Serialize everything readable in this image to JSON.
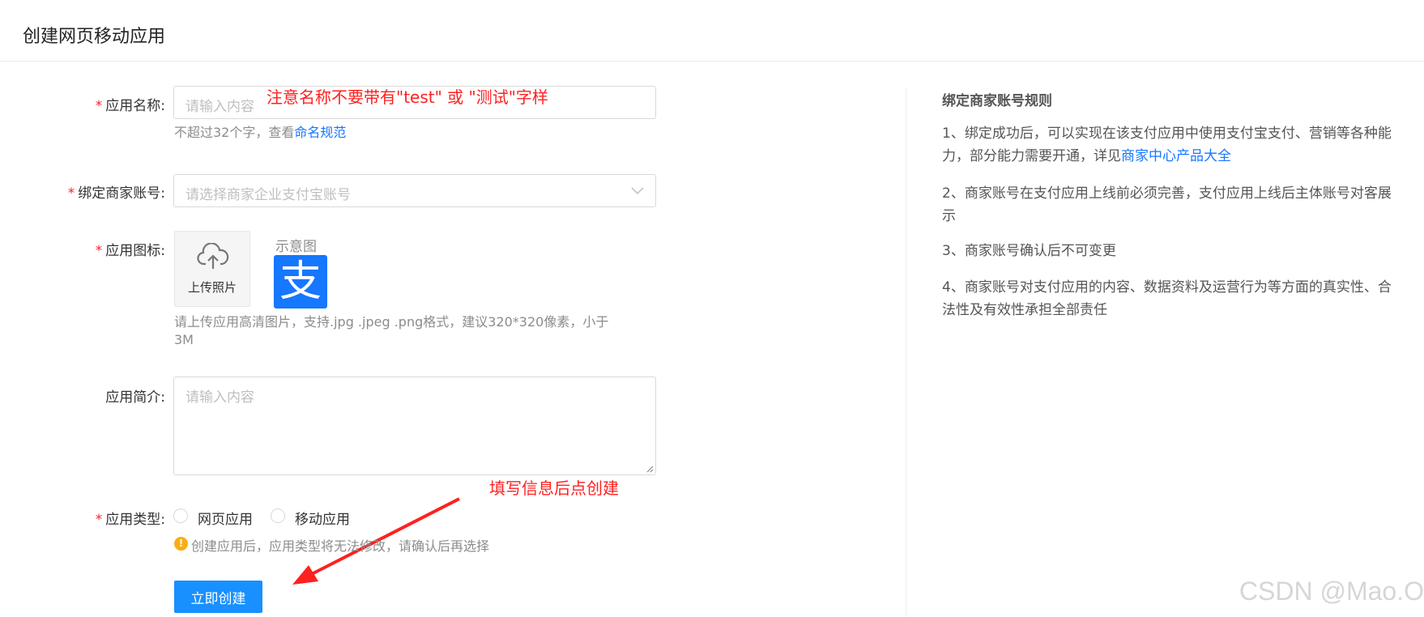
{
  "header": {
    "title": "创建网页移动应用"
  },
  "form": {
    "required_mark": "*",
    "app_name": {
      "label": "应用名称:",
      "placeholder": "请输入内容",
      "hint_prefix": "不超过32个字，查看",
      "hint_link": "命名规范"
    },
    "merchant_account": {
      "label": "绑定商家账号:",
      "placeholder": "请选择商家企业支付宝账号"
    },
    "app_icon": {
      "label": "应用图标:",
      "upload_label": "上传照片",
      "sample_label": "示意图",
      "sample_glyph": "支",
      "hint_line1": "请上传应用高清图片，支持.jpg .jpeg .png格式，建议320*320像素，小于",
      "hint_line2": "3M"
    },
    "app_desc": {
      "label": "应用简介:",
      "placeholder": "请输入内容"
    },
    "app_type": {
      "label": "应用类型:",
      "options": [
        "网页应用",
        "移动应用"
      ],
      "warning_icon": "!",
      "warning": "创建应用后，应用类型将无法修改，请确认后再选择"
    },
    "submit_label": "立即创建"
  },
  "rules": {
    "title": "绑定商家账号规则",
    "items": [
      {
        "text": "1、绑定成功后，可以实现在该支付应用中使用支付宝支付、营销等各种能力，部分能力需要开通，详见",
        "link": "商家中心产品大全"
      },
      {
        "text": "2、商家账号在支付应用上线前必须完善，支付应用上线后主体账号对客展示"
      },
      {
        "text": "3、商家账号确认后不可变更"
      },
      {
        "text": "4、商家账号对支付应用的内容、数据资料及运营行为等方面的真实性、合法性及有效性承担全部责任"
      }
    ]
  },
  "annotations": {
    "name_note": "注意名称不要带有\"test\" 或 \"测试\"字样",
    "create_note": "填写信息后点创建"
  },
  "watermark": "CSDN @Mao.O",
  "colors": {
    "primary": "#1890ff",
    "link": "#1677ff",
    "required": "#f5222d",
    "annotation": "#ff2020",
    "alipay_icon": "#1677ff",
    "warning": "#faad14"
  },
  "icons": {
    "upload": "cloud-upload-icon",
    "select": "chevron-down-icon",
    "sample": "alipay-logo-icon",
    "warning": "warning-icon",
    "arrow": "red-arrow-icon"
  }
}
